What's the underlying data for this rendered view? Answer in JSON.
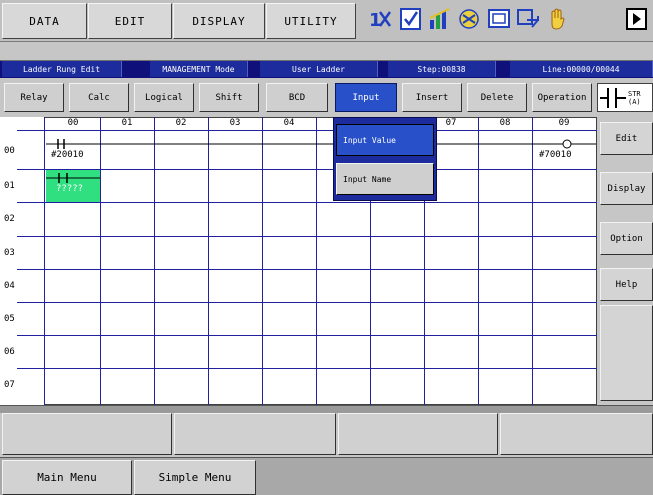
{
  "top_menu": {
    "items": [
      {
        "label": "DATA"
      },
      {
        "label": "EDIT"
      },
      {
        "label": "DISPLAY"
      },
      {
        "label": "UTILITY"
      }
    ],
    "icons": [
      "sort-icon",
      "check-doc-icon",
      "chart-icon",
      "tool-icon",
      "screen-icon",
      "arrow-icon",
      "hand-icon",
      "play-icon"
    ]
  },
  "status": {
    "mode_title": "Ladder Rung Edit",
    "management": "MANAGEMENT Mode",
    "ladder": "User Ladder",
    "step": "Step:00838",
    "line": "Line:00000/00044"
  },
  "function_buttons": [
    {
      "label": "Relay"
    },
    {
      "label": "Calc"
    },
    {
      "label": "Logical"
    },
    {
      "label": "Shift"
    },
    {
      "label": "BCD"
    },
    {
      "label": "Input"
    },
    {
      "label": "Insert"
    },
    {
      "label": "Delete"
    },
    {
      "label": "Operation"
    }
  ],
  "instruction_badge": "STR\n(A)",
  "grid": {
    "columns": [
      "00",
      "01",
      "02",
      "03",
      "04",
      "05",
      "06",
      "07",
      "08",
      "09"
    ],
    "rows": [
      "00",
      "01",
      "02",
      "03",
      "04",
      "05",
      "06",
      "07"
    ],
    "contact_1": "#20010",
    "contact_2": "?????",
    "output_1": "#70010"
  },
  "dropdown": {
    "items": [
      {
        "label": "Input Value"
      },
      {
        "label": "Input Name"
      }
    ]
  },
  "side_menu": [
    {
      "label": "Edit"
    },
    {
      "label": "Display"
    },
    {
      "label": "Option"
    },
    {
      "label": "Help"
    }
  ],
  "bottom_menu": {
    "main": "Main Menu",
    "simple": "Simple Menu"
  },
  "colors": {
    "status_bg": "#1c2c9c",
    "active_button": "#2850c8",
    "cursor_cell": "#30e080"
  }
}
